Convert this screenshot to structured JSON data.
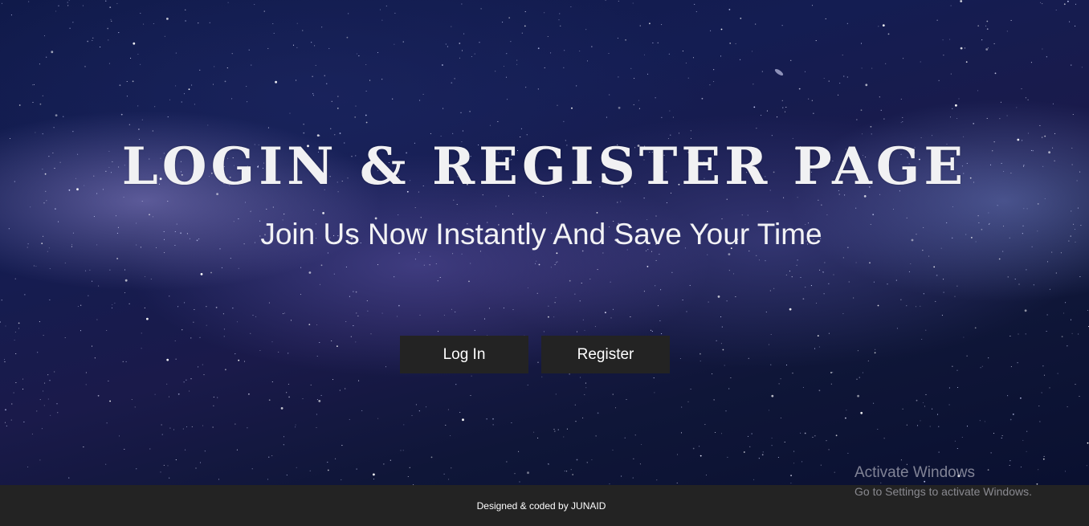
{
  "hero": {
    "title": "LOGIN & REGISTER PAGE",
    "subtitle": "Join Us Now Instantly And Save Your Time"
  },
  "actions": {
    "login_label": "Log In",
    "register_label": "Register"
  },
  "footer": {
    "credit": "Designed & coded by JUNAID"
  },
  "os_watermark": {
    "title": "Activate Windows",
    "subtitle": "Go to Settings to activate Windows."
  },
  "colors": {
    "button_bg": "#232323",
    "footer_bg": "#232323",
    "text": "#ffffff"
  }
}
